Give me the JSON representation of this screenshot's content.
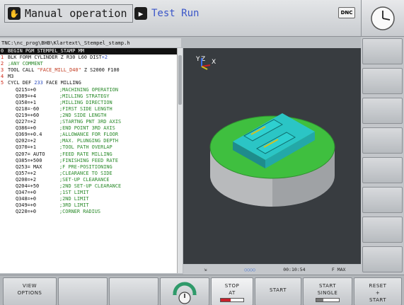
{
  "header": {
    "mode_primary": "Manual operation",
    "mode_secondary": "Test Run",
    "dnc_label": "DNC"
  },
  "program": {
    "path": "TNC:\\nc_prog\\BHB\\Klartext\\_Stempel_stamp.h",
    "lines": [
      {
        "num": "0",
        "text": "BEGIN PGM  STEMPEL_STAMP MM",
        "selected": true
      },
      {
        "num": "1",
        "text": "BLK FORM CYLINDER Z R30 L60 DIST+2",
        "hl": "+2"
      },
      {
        "num": "2",
        "text": ";ANY COMMENT",
        "comment": true
      },
      {
        "num": "3",
        "text": "TOOL CALL \"FACE_MILL_D40\" Z S2000 F100"
      },
      {
        "num": "4",
        "text": "M3"
      },
      {
        "num": "5",
        "text": "CYCL DEF 233 FACE MILLING"
      },
      {
        "sub": true,
        "param": "Q215=+0",
        "comment": ";MACHINING OPERATION"
      },
      {
        "sub": true,
        "param": "Q389=+4",
        "comment": ";MILLING STRATEGY"
      },
      {
        "sub": true,
        "param": "Q350=+1",
        "comment": ";MILLING DIRECTION"
      },
      {
        "sub": true,
        "param": "Q218=-60",
        "comment": ";FIRST SIDE LENGTH"
      },
      {
        "sub": true,
        "param": "Q219=+60",
        "comment": ";2ND SIDE LENGTH"
      },
      {
        "sub": true,
        "param": "Q227=+2",
        "comment": ";STARTNG PNT 3RD AXIS"
      },
      {
        "sub": true,
        "param": "Q386=+0",
        "comment": ";END POINT 3RD AXIS"
      },
      {
        "sub": true,
        "param": "Q369=+0.4",
        "comment": ";ALLOWANCE FOR FLOOR"
      },
      {
        "sub": true,
        "param": "Q202=+2",
        "comment": ";MAX. PLUNGING DEPTH"
      },
      {
        "sub": true,
        "param": "Q370=+1",
        "comment": ";TOOL PATH OVERLAP"
      },
      {
        "sub": true,
        "param": "Q207= AUTO",
        "comment": ";FEED RATE MILLING"
      },
      {
        "sub": true,
        "param": "Q385=+500",
        "comment": ";FINISHING FEED RATE"
      },
      {
        "sub": true,
        "param": "Q253= MAX",
        "comment": ";F PRE-POSITIONING"
      },
      {
        "sub": true,
        "param": "Q357=+2",
        "comment": ";CLEARANCE TO SIDE"
      },
      {
        "sub": true,
        "param": "Q200=+2",
        "comment": ";SET-UP CLEARANCE"
      },
      {
        "sub": true,
        "param": "Q204=+50",
        "comment": ";2ND SET-UP CLEARANCE"
      },
      {
        "sub": true,
        "param": "Q347=+0",
        "comment": ";1ST LIMIT"
      },
      {
        "sub": true,
        "param": "Q348=+0",
        "comment": ";2ND LIMIT"
      },
      {
        "sub": true,
        "param": "Q349=+0",
        "comment": ";3RD LIMIT"
      },
      {
        "sub": true,
        "param": "Q220=+0",
        "comment": ";CORNER RADIUS"
      }
    ]
  },
  "simulation": {
    "axis_labels": [
      "Y",
      "Z",
      "X"
    ]
  },
  "status_bar": {
    "dots": "○○○○",
    "time": "00:10:54",
    "feed": "F MAX"
  },
  "softkeys": {
    "view_options": [
      "VIEW",
      "OPTIONS"
    ],
    "stop_at": [
      "STOP",
      "AT"
    ],
    "start": "START",
    "start_single": [
      "START",
      "SINGLE"
    ],
    "reset_start": [
      "RESET",
      "+",
      "START"
    ]
  },
  "colors": {
    "program_comment": "#2a8a2a",
    "program_value": "#3050c0",
    "program_string": "#c23a20",
    "sim_background": "#383c40",
    "workpiece_top": "#3fbf3f",
    "workpiece_side": "#a8aaac",
    "stamp": "#23b5b5"
  },
  "icons": {
    "mode_primary": "hand-icon",
    "mode_secondary": "test-run-icon",
    "clock": "clock-icon",
    "override": "spindle-override-dial-icon"
  }
}
